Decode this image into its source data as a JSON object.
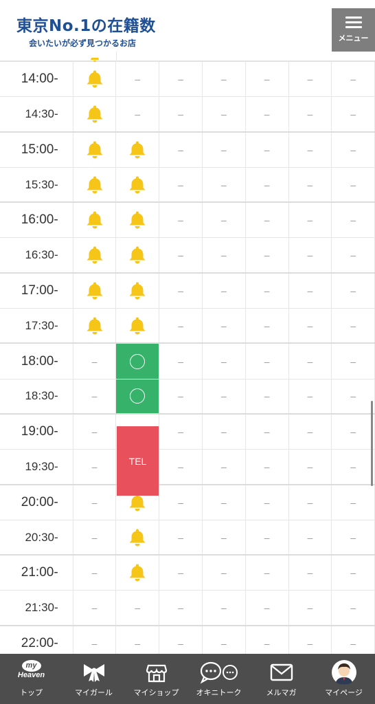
{
  "header": {
    "logo_title": "東京No.1の在籍数",
    "logo_subtitle": "会いたいが必ず見つかるお店",
    "menu_label": "メニュー"
  },
  "schedule": {
    "dash": "–",
    "tel_label": "TEL",
    "rows": [
      {
        "time": "14:00-",
        "half": false,
        "slots": [
          "bell",
          "dash",
          "dash",
          "dash",
          "dash",
          "dash",
          "dash"
        ]
      },
      {
        "time": "14:30-",
        "half": true,
        "slots": [
          "bell",
          "dash",
          "dash",
          "dash",
          "dash",
          "dash",
          "dash"
        ]
      },
      {
        "time": "15:00-",
        "half": false,
        "slots": [
          "bell",
          "bell",
          "dash",
          "dash",
          "dash",
          "dash",
          "dash"
        ]
      },
      {
        "time": "15:30-",
        "half": true,
        "slots": [
          "bell",
          "bell",
          "dash",
          "dash",
          "dash",
          "dash",
          "dash"
        ]
      },
      {
        "time": "16:00-",
        "half": false,
        "slots": [
          "bell",
          "bell",
          "dash",
          "dash",
          "dash",
          "dash",
          "dash"
        ]
      },
      {
        "time": "16:30-",
        "half": true,
        "slots": [
          "bell",
          "bell",
          "dash",
          "dash",
          "dash",
          "dash",
          "dash"
        ]
      },
      {
        "time": "17:00-",
        "half": false,
        "slots": [
          "bell",
          "bell",
          "dash",
          "dash",
          "dash",
          "dash",
          "dash"
        ]
      },
      {
        "time": "17:30-",
        "half": true,
        "slots": [
          "bell",
          "bell",
          "dash",
          "dash",
          "dash",
          "dash",
          "dash"
        ]
      },
      {
        "time": "18:00-",
        "half": false,
        "slots": [
          "dash",
          "available",
          "dash",
          "dash",
          "dash",
          "dash",
          "dash"
        ]
      },
      {
        "time": "18:30-",
        "half": true,
        "slots": [
          "dash",
          "available",
          "dash",
          "dash",
          "dash",
          "dash",
          "dash"
        ]
      },
      {
        "time": "19:00-",
        "half": false,
        "slots": [
          "dash",
          "tel",
          "dash",
          "dash",
          "dash",
          "dash",
          "dash"
        ]
      },
      {
        "time": "19:30-",
        "half": true,
        "slots": [
          "dash",
          "tel",
          "dash",
          "dash",
          "dash",
          "dash",
          "dash"
        ]
      },
      {
        "time": "20:00-",
        "half": false,
        "slots": [
          "dash",
          "bell",
          "dash",
          "dash",
          "dash",
          "dash",
          "dash"
        ]
      },
      {
        "time": "20:30-",
        "half": true,
        "slots": [
          "dash",
          "bell",
          "dash",
          "dash",
          "dash",
          "dash",
          "dash"
        ]
      },
      {
        "time": "21:00-",
        "half": false,
        "slots": [
          "dash",
          "bell",
          "dash",
          "dash",
          "dash",
          "dash",
          "dash"
        ]
      },
      {
        "time": "21:30-",
        "half": true,
        "slots": [
          "dash",
          "dash",
          "dash",
          "dash",
          "dash",
          "dash",
          "dash"
        ]
      },
      {
        "time": "22:00-",
        "half": false,
        "slots": [
          "dash",
          "dash",
          "dash",
          "dash",
          "dash",
          "dash",
          "dash"
        ]
      }
    ]
  },
  "colors": {
    "bell": "#f5c518",
    "available": "#36b26a",
    "tel": "#e8515c",
    "nav_bg": "#4d4d4d",
    "logo_blue": "#1f4f95"
  },
  "bottom_nav": [
    {
      "label": "トップ",
      "icon": "my-heaven-icon",
      "badge_top": "my",
      "badge_bottom": "Heaven"
    },
    {
      "label": "マイガール",
      "icon": "ribbon-icon"
    },
    {
      "label": "マイショップ",
      "icon": "shop-icon"
    },
    {
      "label": "オキニトーク",
      "icon": "chat-icon"
    },
    {
      "label": "メルマガ",
      "icon": "mail-icon"
    },
    {
      "label": "マイページ",
      "icon": "avatar-icon"
    }
  ]
}
